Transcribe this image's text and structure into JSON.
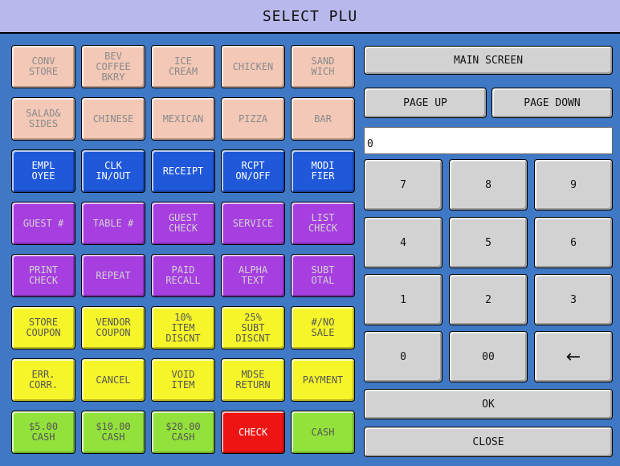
{
  "title": "SELECT PLU",
  "colors": {
    "background": "#3f78c4",
    "title_bar": "#b8b8ec",
    "peach": "#f3c8b6",
    "blue": "#1f58d8",
    "purple": "#a63ee0",
    "yellow": "#f5f52a",
    "green": "#93e23c",
    "red": "#ee1414",
    "grey": "#d2d2d2"
  },
  "plu_grid": [
    [
      {
        "label": "CONV\nSTORE",
        "color": "peach"
      },
      {
        "label": "BEV\nCOFFEE\nBKRY",
        "color": "peach"
      },
      {
        "label": "ICE\nCREAM",
        "color": "peach"
      },
      {
        "label": "CHICKEN",
        "color": "peach"
      },
      {
        "label": "SAND\nWICH",
        "color": "peach"
      }
    ],
    [
      {
        "label": "SALAD&\nSIDES",
        "color": "peach"
      },
      {
        "label": "CHINESE",
        "color": "peach"
      },
      {
        "label": "MEXICAN",
        "color": "peach"
      },
      {
        "label": "PIZZA",
        "color": "peach"
      },
      {
        "label": "BAR",
        "color": "peach"
      }
    ],
    [
      {
        "label": "EMPL\nOYEE",
        "color": "blue"
      },
      {
        "label": "CLK\nIN/OUT",
        "color": "blue"
      },
      {
        "label": "RECEIPT",
        "color": "blue"
      },
      {
        "label": "RCPT\nON/OFF",
        "color": "blue"
      },
      {
        "label": "MODI\nFIER",
        "color": "blue"
      }
    ],
    [
      {
        "label": "GUEST #",
        "color": "purple"
      },
      {
        "label": "TABLE #",
        "color": "purple"
      },
      {
        "label": "GUEST\nCHECK",
        "color": "purple"
      },
      {
        "label": "SERVICE",
        "color": "purple"
      },
      {
        "label": "LIST\nCHECK",
        "color": "purple"
      }
    ],
    [
      {
        "label": "PRINT\nCHECK",
        "color": "purple"
      },
      {
        "label": "REPEAT",
        "color": "purple"
      },
      {
        "label": "PAID\nRECALL",
        "color": "purple"
      },
      {
        "label": "ALPHA\nTEXT",
        "color": "purple"
      },
      {
        "label": "SUBT\nOTAL",
        "color": "purple"
      }
    ],
    [
      {
        "label": "STORE\nCOUPON",
        "color": "yellow"
      },
      {
        "label": "VENDOR\nCOUPON",
        "color": "yellow"
      },
      {
        "label": "10%\nITEM\nDISCNT",
        "color": "yellow"
      },
      {
        "label": "25%\nSUBT\nDISCNT",
        "color": "yellow"
      },
      {
        "label": "#/NO\nSALE",
        "color": "yellow"
      }
    ],
    [
      {
        "label": "ERR.\nCORR.",
        "color": "yellow"
      },
      {
        "label": "CANCEL",
        "color": "yellow"
      },
      {
        "label": "VOID\nITEM",
        "color": "yellow"
      },
      {
        "label": "MDSE\nRETURN",
        "color": "yellow"
      },
      {
        "label": "PAYMENT",
        "color": "yellow"
      }
    ],
    [
      {
        "label": "$5.00\nCASH",
        "color": "green"
      },
      {
        "label": "$10.00\nCASH",
        "color": "green"
      },
      {
        "label": "$20.00\nCASH",
        "color": "green"
      },
      {
        "label": "CHECK",
        "color": "red"
      },
      {
        "label": "CASH",
        "color": "green"
      }
    ]
  ],
  "controls": {
    "main_screen": "MAIN SCREEN",
    "page_up": "PAGE UP",
    "page_down": "PAGE DOWN",
    "display_value": "0",
    "ok": "OK",
    "close": "CLOSE"
  },
  "keypad": [
    [
      "7",
      "8",
      "9"
    ],
    [
      "4",
      "5",
      "6"
    ],
    [
      "1",
      "2",
      "3"
    ],
    [
      "0",
      "00",
      "←"
    ]
  ]
}
